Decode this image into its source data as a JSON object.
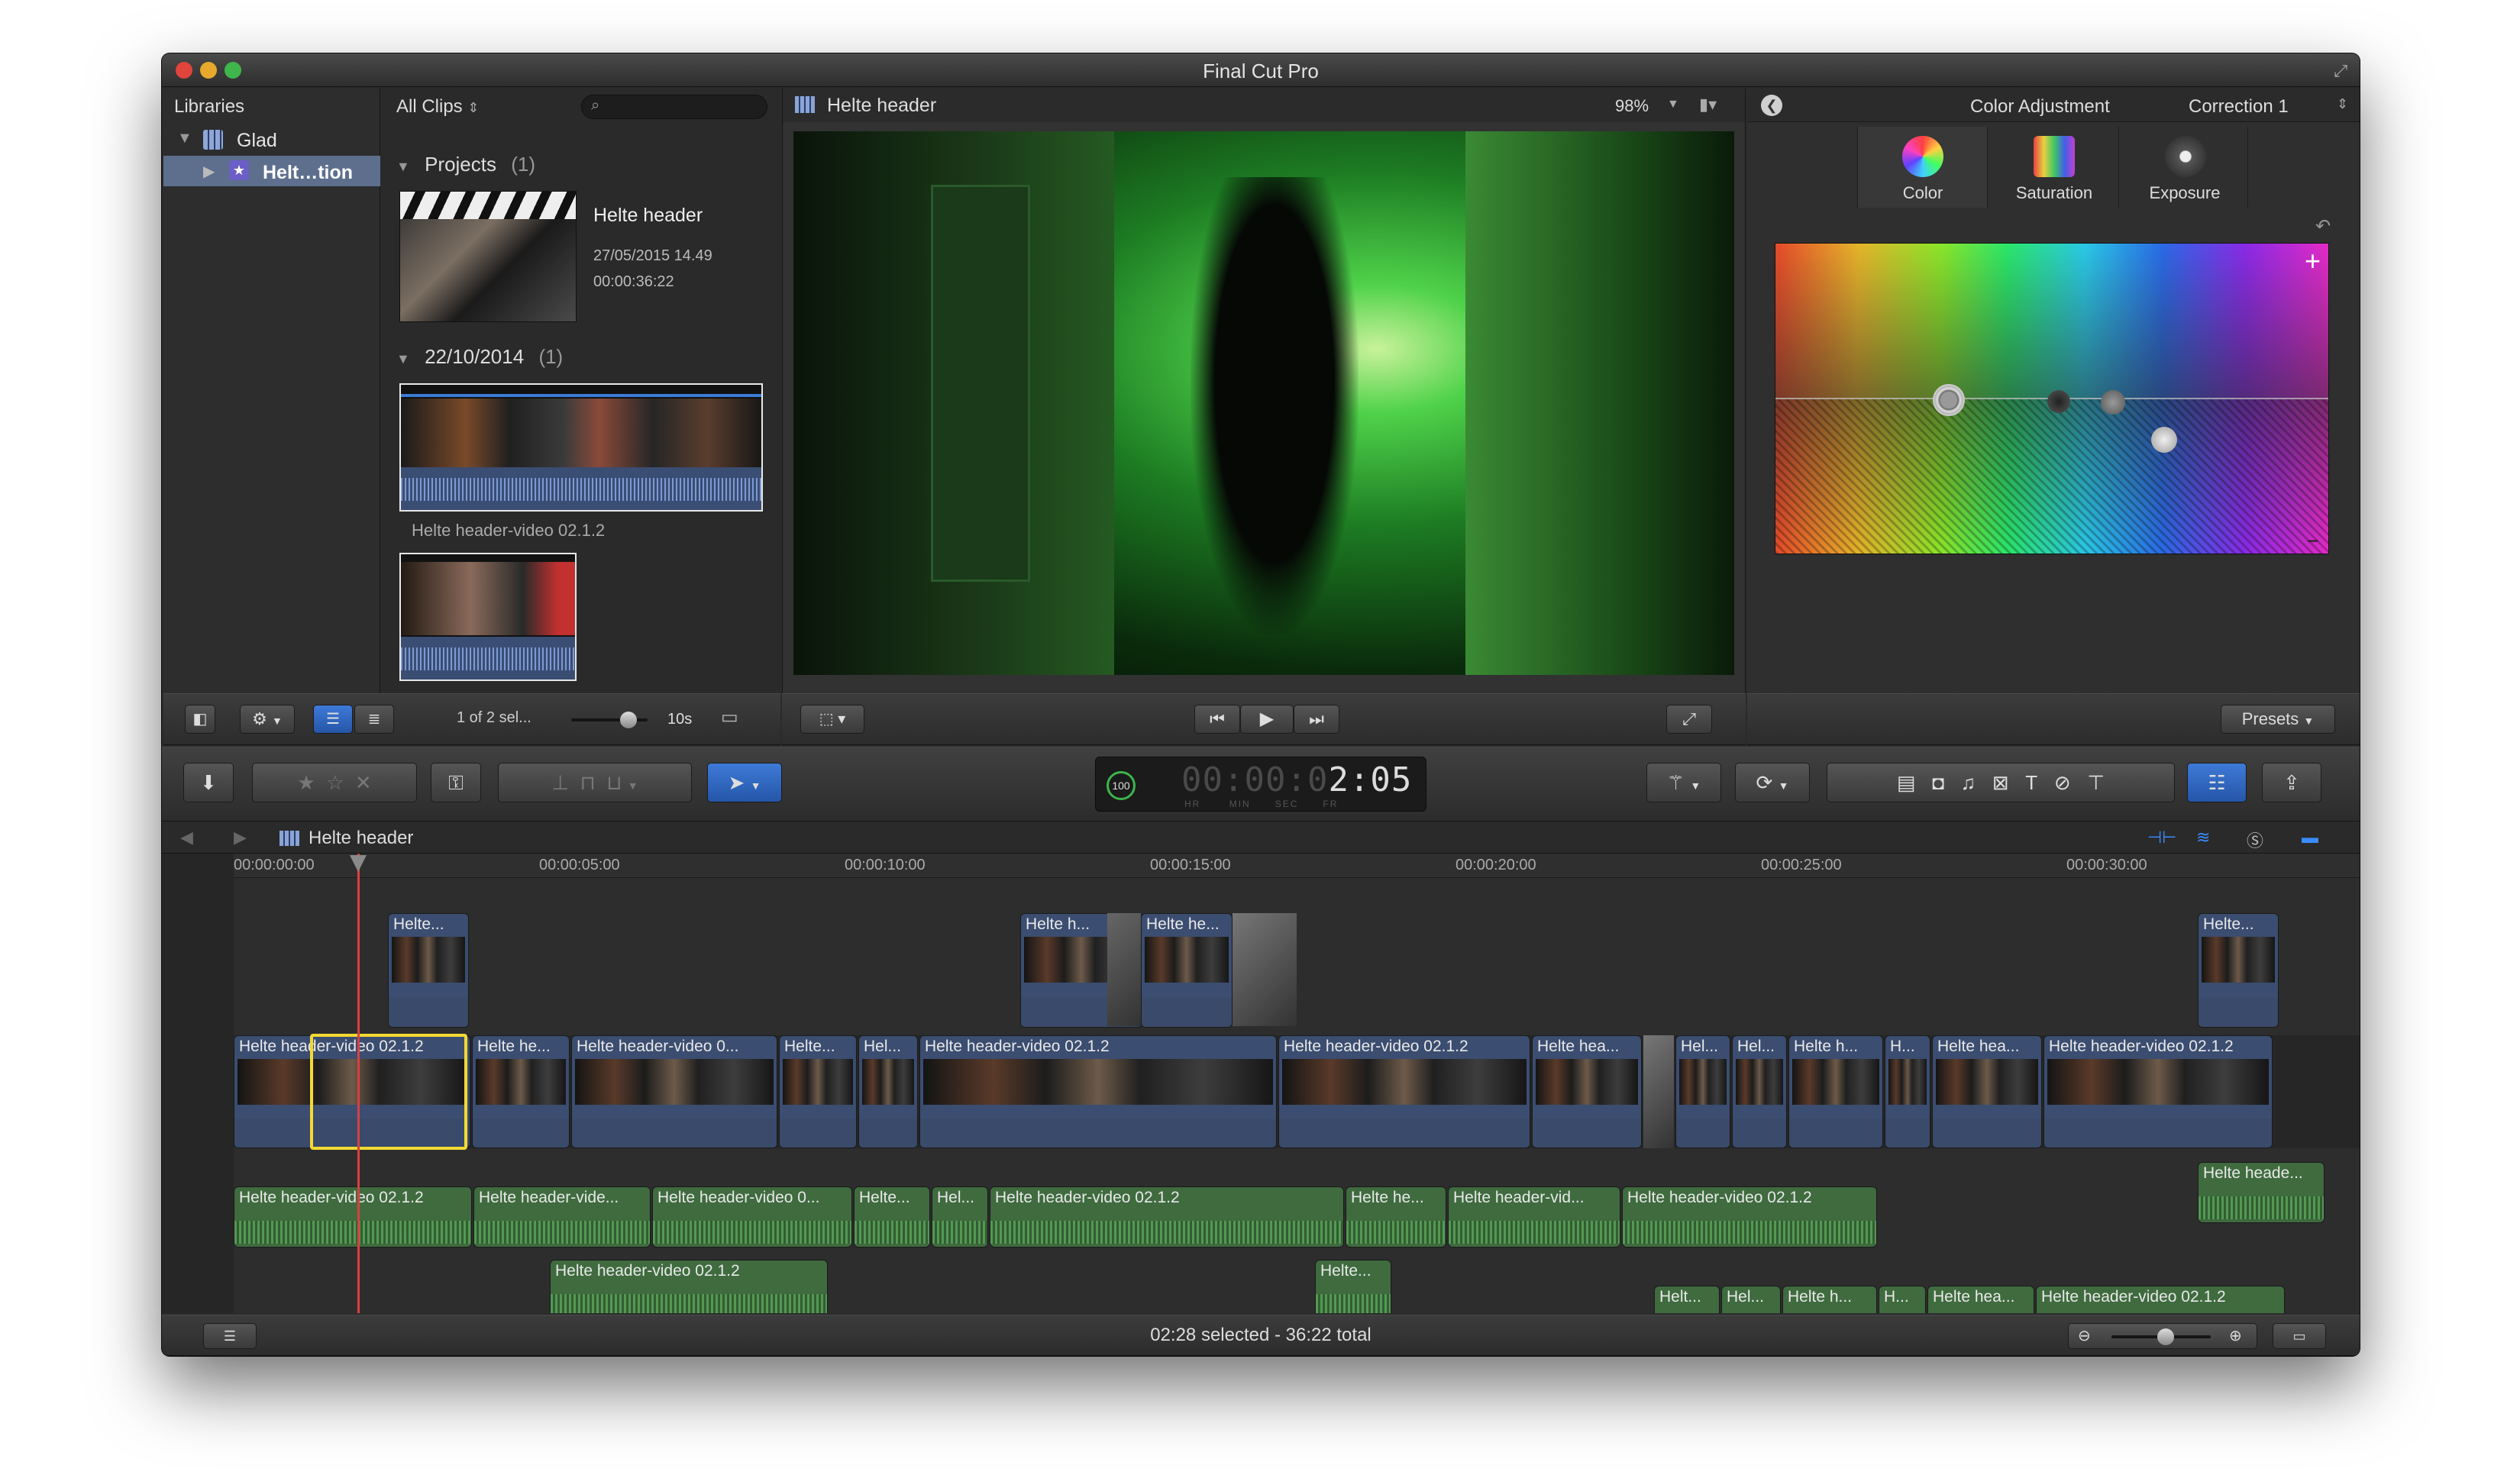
{
  "app": {
    "title": "Final Cut Pro"
  },
  "libraries": {
    "header": "Libraries",
    "tree": [
      {
        "label": "Glad"
      },
      {
        "label": "Helt…tion"
      }
    ]
  },
  "browser": {
    "filter": "All Clips",
    "projects_group": "Projects",
    "projects_count": "(1)",
    "project": {
      "name": "Helte header",
      "date": "27/05/2015 14.49",
      "duration": "00:00:36:22"
    },
    "date_group": "22/10/2014",
    "date_count": "(1)",
    "clip_name": "Helte header-video 02.1.2",
    "selection": "1 of 2 sel...",
    "zoom_label": "10s"
  },
  "viewer": {
    "title": "Helte header",
    "zoom": "98%"
  },
  "inspector": {
    "title": "Color Adjustment",
    "correction": "Correction 1",
    "tabs": [
      {
        "label": "Color"
      },
      {
        "label": "Saturation"
      },
      {
        "label": "Exposure"
      }
    ],
    "presets": "Presets"
  },
  "toolbar": {
    "timecode_pct": "100",
    "timecode": "00:00:02:05",
    "timecode_dim": "00:00:0",
    "timecode_bright": "2:05",
    "tc_units": [
      "HR",
      "MIN",
      "SEC",
      "FR"
    ]
  },
  "timeline": {
    "title": "Helte header",
    "ruler": [
      "00:00:00:00",
      "00:00:05:00",
      "00:00:10:00",
      "00:00:15:00",
      "00:00:20:00",
      "00:00:25:00",
      "00:00:30:00"
    ],
    "connected_top": [
      "Helte...",
      "Helte h...",
      "Helte he...",
      "Helte..."
    ],
    "primary": [
      "Helte header-video 02.1.2",
      "Helte he...",
      "Helte header-video 0...",
      "Helte...",
      "Hel...",
      "Helte header-video 02.1.2",
      "Helte header-video 02.1.2",
      "Helte hea...",
      "Hel...",
      "Hel...",
      "Helte h...",
      "H...",
      "Helte hea...",
      "Helte header-video 02.1.2"
    ],
    "audio1": [
      "Helte header-video 02.1.2",
      "Helte header-vide...",
      "Helte header-video 0...",
      "Helte...",
      "Hel...",
      "Helte header-video 02.1.2",
      "Helte he...",
      "Helte header-vid...",
      "Helte header-video 02.1.2"
    ],
    "audio_right": "Helte heade...",
    "audio2": [
      "Helte header-video 02.1.2",
      "Helte..."
    ],
    "audio3": [
      "Helt...",
      "Hel...",
      "Helte h...",
      "H...",
      "Helte hea...",
      "Helte header-video 02.1.2"
    ]
  },
  "status": {
    "text": "02:28 selected - 36:22 total"
  }
}
